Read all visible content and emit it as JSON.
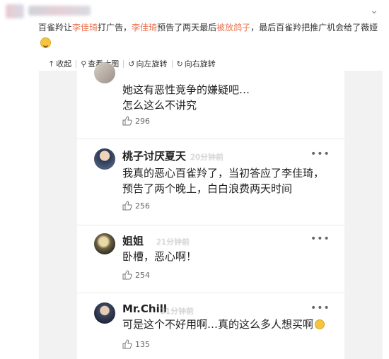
{
  "post": {
    "text_prefix": "百雀羚让",
    "link1": "李佳琦",
    "text2": "打广告，",
    "link2": "李佳琦",
    "text3": "预告了两天最后",
    "link3": "被放鸽子",
    "text4": "，最后百雀羚把推广机会给了薇娅",
    "emoji": "laughing-tears-emoji"
  },
  "toolbar": {
    "collapse": "收起",
    "view_large": "查看大图",
    "rotate_left": "向左旋转",
    "rotate_right": "向右旋转"
  },
  "comments": [
    {
      "name": "",
      "time": "",
      "lines": [
        "她这有恶性竞争的嫌疑吧…",
        "怎么这么不讲究"
      ],
      "likes": "296"
    },
    {
      "name": "桃子讨厌夏天",
      "time": "20分钟前",
      "lines": [
        "我真的恶心百雀羚了，当初答应了李佳琦，",
        "预告了两个晚上，白白浪费两天时间"
      ],
      "likes": "256"
    },
    {
      "name": "姐姐",
      "time": "21分钟前",
      "lines": [
        "卧槽，恶心啊！"
      ],
      "likes": "254"
    },
    {
      "name": "Mr.Chill",
      "time": "31分钟前",
      "lines": [
        "可是这个不好用啊…真的这么多人想买啊"
      ],
      "likes": "135"
    }
  ],
  "colors": {
    "link": "#eb7350",
    "panel_bg": "#f2f2f2"
  }
}
